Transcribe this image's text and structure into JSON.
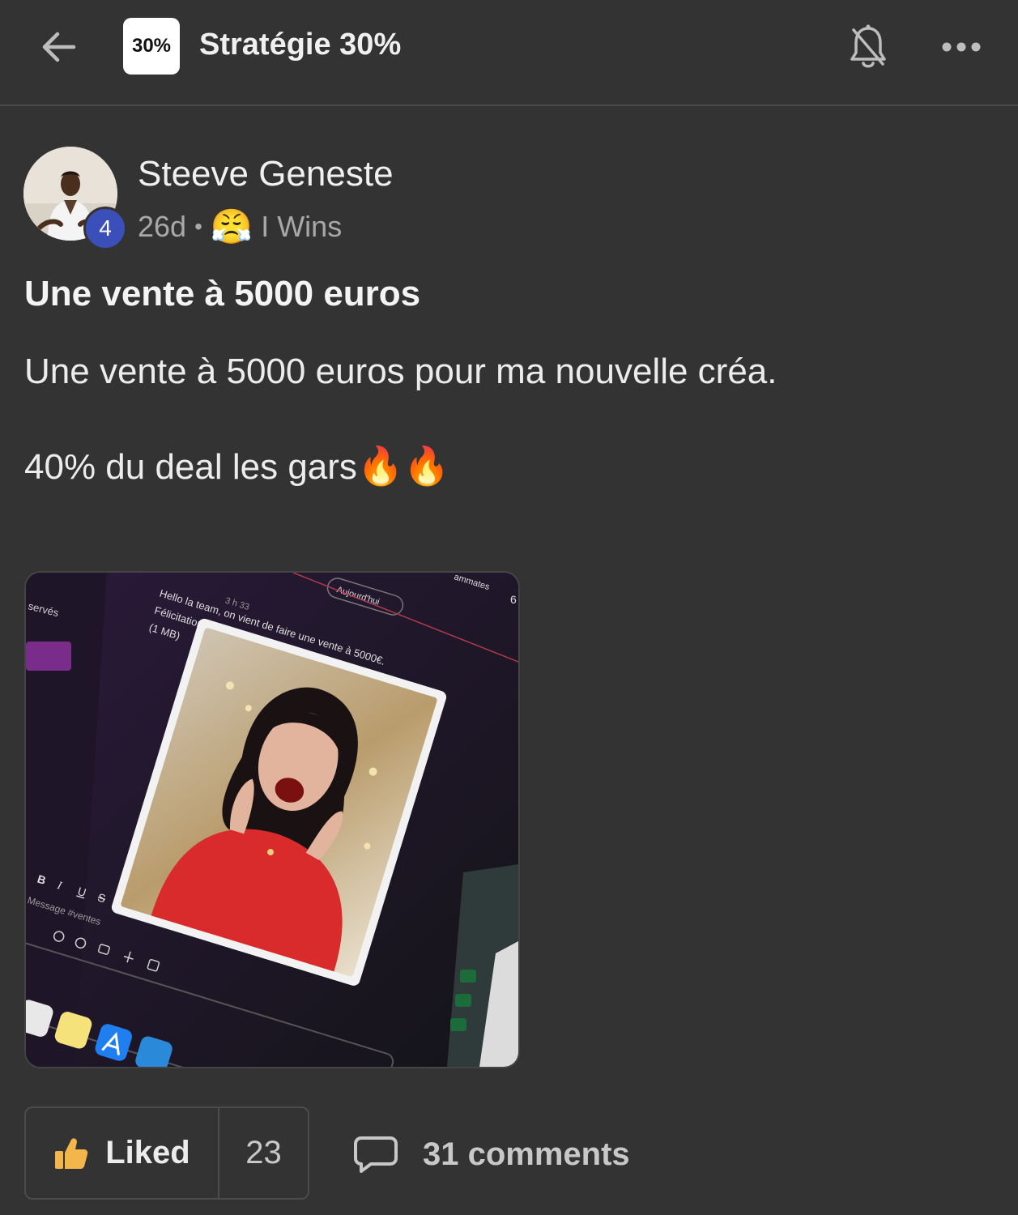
{
  "header": {
    "back_icon": "arrow-left-icon",
    "group_logo_text": "30%",
    "group_name": "Stratégie 30%",
    "bell_icon": "bell-off-icon",
    "more_icon": "more-horizontal-icon"
  },
  "post": {
    "author": {
      "name": "Steeve Geneste",
      "level": "4"
    },
    "age": "26d",
    "separator": "•",
    "category_emoji": "😤",
    "category": "I Wins",
    "title": "Une vente à 5000 euros",
    "body_line1": "Une vente à 5000 euros pour ma nouvelle créa.",
    "body_line2": "40% du deal les gars",
    "body_emoji": "🔥🔥",
    "attachment": {
      "time": "3 h 33",
      "line1": "Hello la team, on vient de faire une vente à 5000€.",
      "line2": "Félicitations, Coach Marjo!",
      "line3": "(1 MB)",
      "date_chip": "Aujourd'hui",
      "side_text": "servés",
      "corner_text": "ammates",
      "corner_num": "6",
      "composer_placeholder": "Message #ventes",
      "format_letters": [
        "B",
        "I",
        "U",
        "S"
      ]
    },
    "actions": {
      "like_label": "Liked",
      "like_count": "23",
      "comments_label": "31 comments"
    }
  },
  "colors": {
    "background": "#333333",
    "level_badge": "#3b4fb8",
    "like_icon": "#f3b64a"
  }
}
